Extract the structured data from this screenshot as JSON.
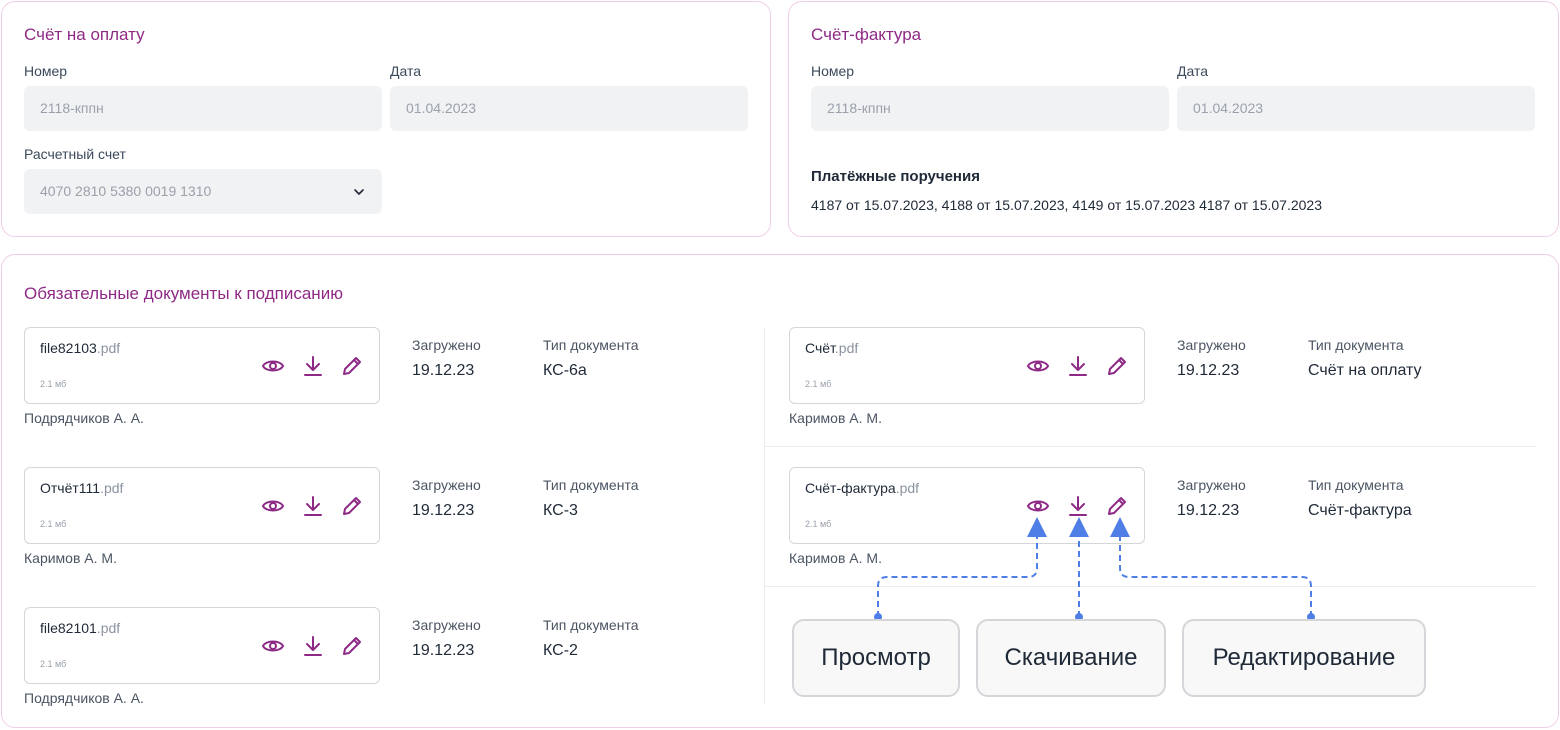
{
  "invoice": {
    "title": "Счёт на оплату",
    "number_label": "Номер",
    "number_value": "2118-кппн",
    "date_label": "Дата",
    "date_value": "01.04.2023",
    "account_label": "Расчетный счет",
    "account_value": "4070 2810 5380 0019 1310"
  },
  "facture": {
    "title": "Счёт-фактура",
    "number_label": "Номер",
    "number_value": "2118-кппн",
    "date_label": "Дата",
    "date_value": "01.04.2023",
    "payments_title": "Платёжные поручения",
    "payments_text": "4187 от 15.07.2023, 4188 от 15.07.2023, 4149 от 15.07.2023 4187 от 15.07.2023"
  },
  "docs": {
    "title": "Обязательные документы к подписанию",
    "uploaded_label": "Загружено",
    "type_label": "Тип документа",
    "items": [
      {
        "name": "file82103",
        "ext": ".pdf",
        "size": "2.1 мб",
        "author": "Подрядчиков А. А.",
        "uploaded": "19.12.23",
        "type": "КС-6а"
      },
      {
        "name": "Счёт",
        "ext": ".pdf",
        "size": "2.1 мб",
        "author": "Каримов А. М.",
        "uploaded": "19.12.23",
        "type": "Счёт на оплату"
      },
      {
        "name": "Отчёт111",
        "ext": ".pdf",
        "size": "2.1 мб",
        "author": "Каримов А. М.",
        "uploaded": "19.12.23",
        "type": "КС-3"
      },
      {
        "name": "Счёт-фактура",
        "ext": ".pdf",
        "size": "2.1 мб",
        "author": "Каримов А. М.",
        "uploaded": "19.12.23",
        "type": "Счёт-фактура"
      },
      {
        "name": "file82101",
        "ext": ".pdf",
        "size": "2.1 мб",
        "author": "Подрядчиков А. А.",
        "uploaded": "19.12.23",
        "type": "КС-2"
      }
    ]
  },
  "tooltips": {
    "view": "Просмотр",
    "download": "Скачивание",
    "edit": "Редактирование"
  },
  "colors": {
    "accent": "#8e2a86",
    "card_border": "#f0cfe6",
    "annotation": "#4f7fe6"
  },
  "icons": {
    "view": "eye-icon",
    "download": "download-icon",
    "edit": "pencil-icon",
    "select": "chevron-down-icon"
  }
}
